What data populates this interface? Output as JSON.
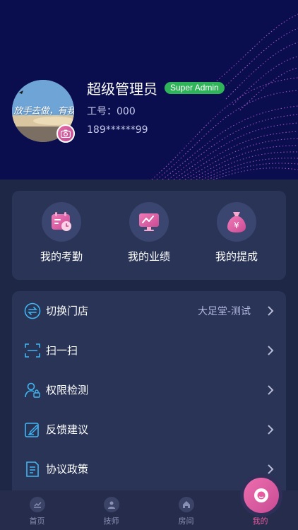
{
  "profile": {
    "name": "超级管理员",
    "role_badge": "Super Admin",
    "employee_id": "工号：000",
    "phone": "189******99",
    "avatar_text": "放手去做，有我!"
  },
  "quick_actions": [
    {
      "label": "我的考勤",
      "icon": "calendar-clock-icon"
    },
    {
      "label": "我的业绩",
      "icon": "performance-chart-icon"
    },
    {
      "label": "我的提成",
      "icon": "money-bag-icon"
    }
  ],
  "menu": [
    {
      "label": "切换门店",
      "value": "大足堂-测试",
      "icon": "switch-arrows-icon"
    },
    {
      "label": "扫一扫",
      "value": "",
      "icon": "scan-icon"
    },
    {
      "label": "权限检测",
      "value": "",
      "icon": "user-lock-icon"
    },
    {
      "label": "反馈建议",
      "value": "",
      "icon": "edit-note-icon"
    },
    {
      "label": "协议政策",
      "value": "",
      "icon": "document-icon"
    }
  ],
  "tabs": [
    {
      "label": "首页",
      "icon": "chart-icon"
    },
    {
      "label": "技师",
      "icon": "person-icon"
    },
    {
      "label": "房间",
      "icon": "home-icon"
    },
    {
      "label": "我的",
      "icon": "user-icon",
      "active": true
    }
  ],
  "colors": {
    "header_bg": "#0b0e4e",
    "page_bg": "#1f2746",
    "card_bg": "#2a3456",
    "accent_pink": "#e85ba0",
    "badge_green": "#2fb45a"
  }
}
